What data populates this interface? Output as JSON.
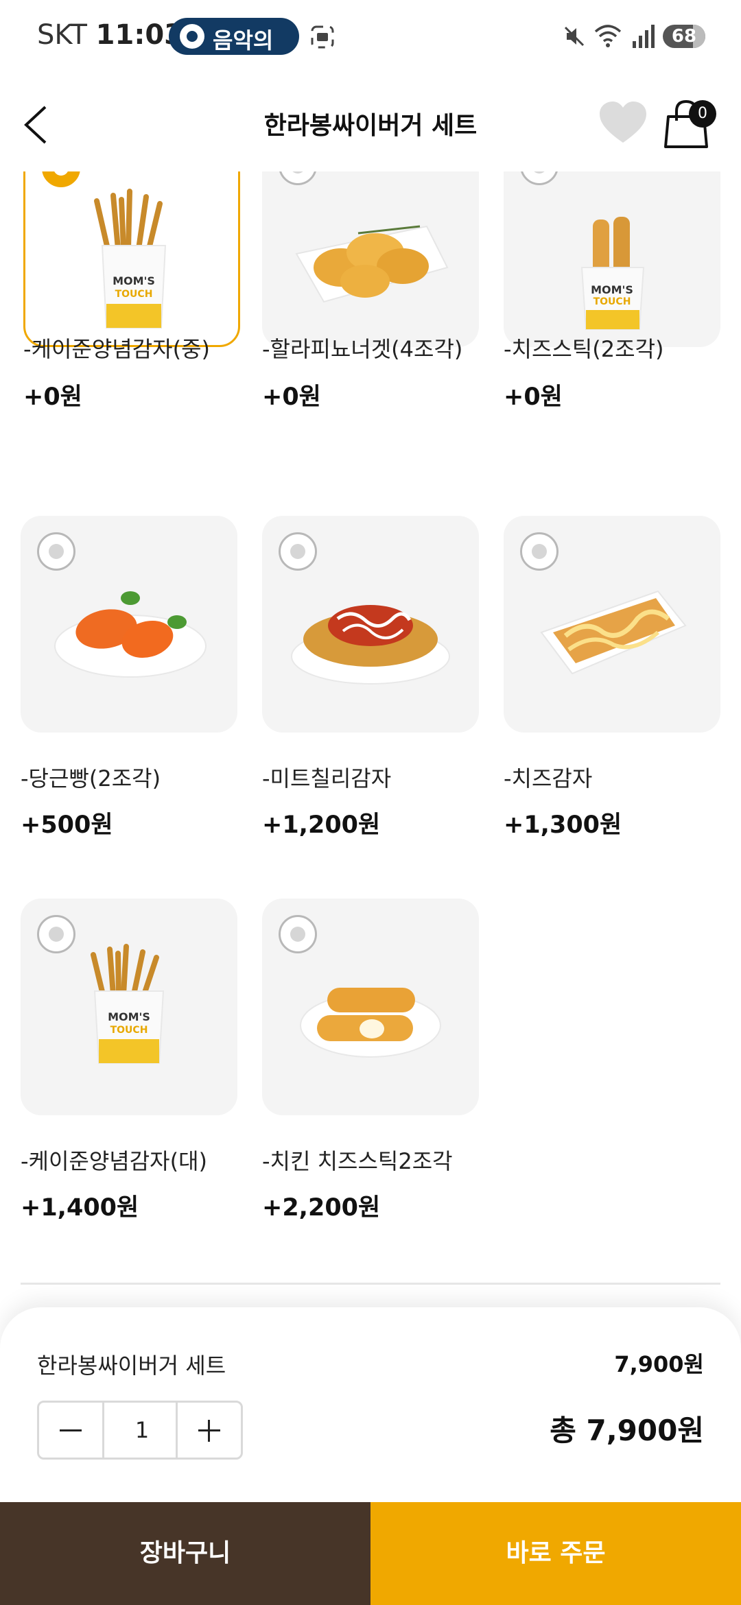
{
  "status_bar": {
    "carrier": "SKT",
    "time": "11:03",
    "music_label": "음악의",
    "battery": "68"
  },
  "header": {
    "title": "한라봉싸이버거 세트",
    "cart_count": "0"
  },
  "options": [
    {
      "name": "-케이준양념감자(중)",
      "price": "+0원",
      "selected": true,
      "image": "fries-bag-icon"
    },
    {
      "name": "-할라피뇨너겟(4조각)",
      "price": "+0원",
      "selected": false,
      "image": "nuggets-icon"
    },
    {
      "name": "-치즈스틱(2조각)",
      "price": "+0원",
      "selected": false,
      "image": "cheese-stick-bag-icon"
    },
    {
      "name": "-당근빵(2조각)",
      "price": "+500원",
      "selected": false,
      "image": "carrot-bread-icon"
    },
    {
      "name": "-미트칠리감자",
      "price": "+1,200원",
      "selected": false,
      "image": "chili-fries-icon"
    },
    {
      "name": "-치즈감자",
      "price": "+1,300원",
      "selected": false,
      "image": "cheese-fries-icon"
    },
    {
      "name": "-케이준양념감자(대)",
      "price": "+1,400원",
      "selected": false,
      "image": "fries-bag-icon"
    },
    {
      "name": "-치킨 치즈스틱2조각",
      "price": "+2,200원",
      "selected": false,
      "image": "chicken-cheese-stick-icon"
    }
  ],
  "summary": {
    "item_name": "한라봉싸이버거 세트",
    "item_price": "7,900원",
    "quantity": "1",
    "total": "총 7,900원"
  },
  "footer": {
    "cart_button": "장바구니",
    "order_button": "바로 주문"
  },
  "colors": {
    "accent": "#f0a800",
    "dark_button": "#473528"
  }
}
